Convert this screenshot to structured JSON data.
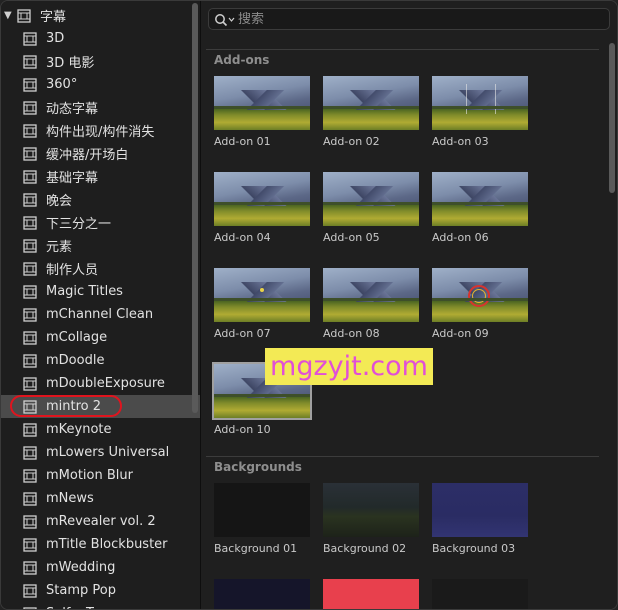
{
  "sidebar": {
    "root": {
      "label": "字幕",
      "expanded": true
    },
    "items": [
      {
        "label": "3D"
      },
      {
        "label": "3D 电影"
      },
      {
        "label": "360°"
      },
      {
        "label": "动态字幕"
      },
      {
        "label": "构件出现/构件消失"
      },
      {
        "label": "缓冲器/开场白"
      },
      {
        "label": "基础字幕"
      },
      {
        "label": "晚会"
      },
      {
        "label": "下三分之一"
      },
      {
        "label": "元素"
      },
      {
        "label": "制作人员"
      },
      {
        "label": "Magic Titles"
      },
      {
        "label": "mChannel Clean"
      },
      {
        "label": "mCollage"
      },
      {
        "label": "mDoodle"
      },
      {
        "label": "mDoubleExposure"
      },
      {
        "label": "mintro 2",
        "selected": true
      },
      {
        "label": "mKeynote"
      },
      {
        "label": "mLowers Universal"
      },
      {
        "label": "mMotion Blur"
      },
      {
        "label": "mNews"
      },
      {
        "label": "mRevealer vol. 2"
      },
      {
        "label": "mTitle Blockbuster"
      },
      {
        "label": "mWedding"
      },
      {
        "label": "Stamp Pop"
      },
      {
        "label": "Self... T..."
      }
    ]
  },
  "search": {
    "placeholder": "搜索",
    "value": ""
  },
  "sections": [
    {
      "title": "Add-ons",
      "tiles": [
        {
          "label": "Add-on 01"
        },
        {
          "label": "Add-on 02"
        },
        {
          "label": "Add-on 03"
        },
        {
          "label": "Add-on 04"
        },
        {
          "label": "Add-on 05"
        },
        {
          "label": "Add-on 06"
        },
        {
          "label": "Add-on 07"
        },
        {
          "label": "Add-on 08"
        },
        {
          "label": "Add-on 09"
        },
        {
          "label": "Add-on 10"
        }
      ]
    },
    {
      "title": "Backgrounds",
      "tiles": [
        {
          "label": "Background 01"
        },
        {
          "label": "Background 02"
        },
        {
          "label": "Background 03"
        }
      ]
    }
  ],
  "watermark": {
    "text": "mgzyjt.com"
  },
  "colors": {
    "selection_bg": "#4b4b4b",
    "annotation_red": "#e0141e",
    "watermark_bg": "#f3ea55",
    "watermark_text": "#e14fd7"
  }
}
